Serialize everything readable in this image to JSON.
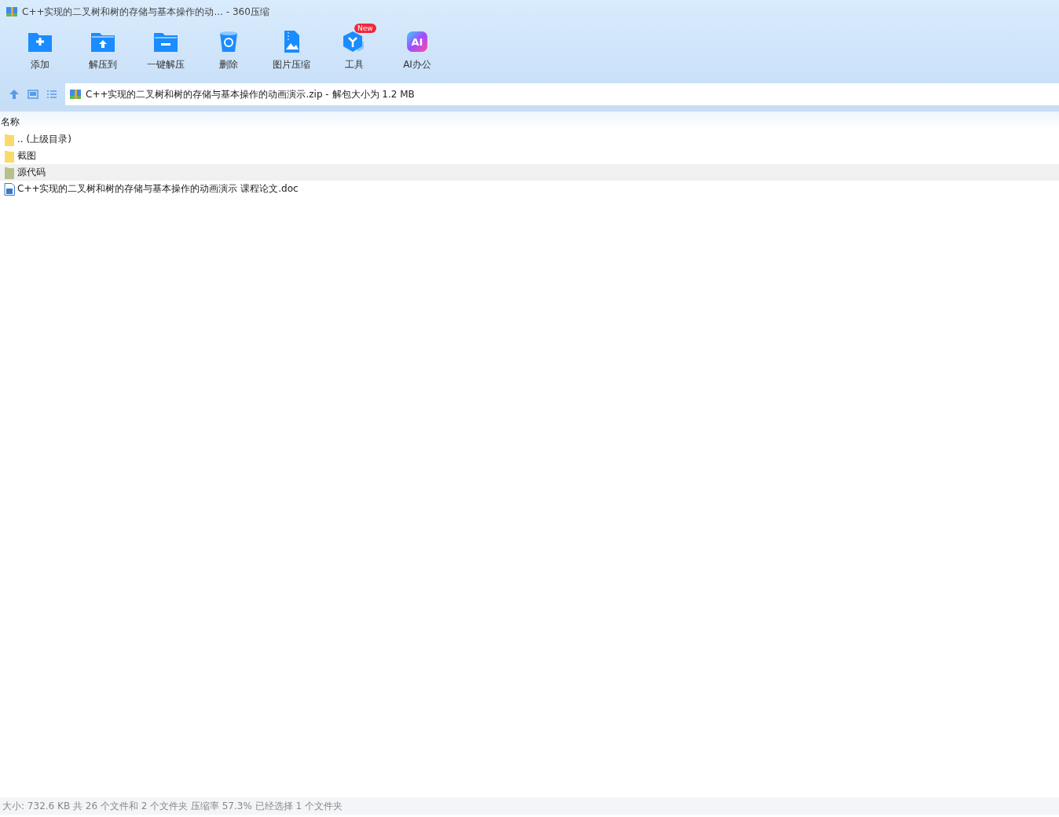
{
  "window": {
    "title": "C++实现的二叉树和树的存储与基本操作的动... - 360压缩"
  },
  "toolbar": [
    {
      "kind": "add",
      "label": "添加"
    },
    {
      "kind": "extract",
      "label": "解压到"
    },
    {
      "kind": "oneclick",
      "label": "一键解压"
    },
    {
      "kind": "delete",
      "label": "删除"
    },
    {
      "kind": "image",
      "label": "图片压缩"
    },
    {
      "kind": "tools",
      "label": "工具",
      "badge": "New"
    },
    {
      "kind": "ai",
      "label": "AI办公",
      "icon_text": "AI"
    }
  ],
  "address": {
    "path": "C++实现的二叉树和树的存储与基本操作的动画演示.zip - 解包大小为 1.2 MB"
  },
  "table": {
    "columns": [
      "名称"
    ],
    "rows": [
      {
        "kind": "folder",
        "name": ".. (上级目录)",
        "selected": false
      },
      {
        "kind": "folder",
        "name": "截图",
        "selected": false
      },
      {
        "kind": "folder",
        "name": "源代码",
        "selected": true
      },
      {
        "kind": "doc",
        "name": "C++实现的二叉树和树的存储与基本操作的动画演示 课程论文.doc",
        "selected": false
      }
    ]
  },
  "status_bar": "大小: 732.6 KB 共 26 个文件和 2 个文件夹 压缩率 57.3% 已经选择 1 个文件夹"
}
